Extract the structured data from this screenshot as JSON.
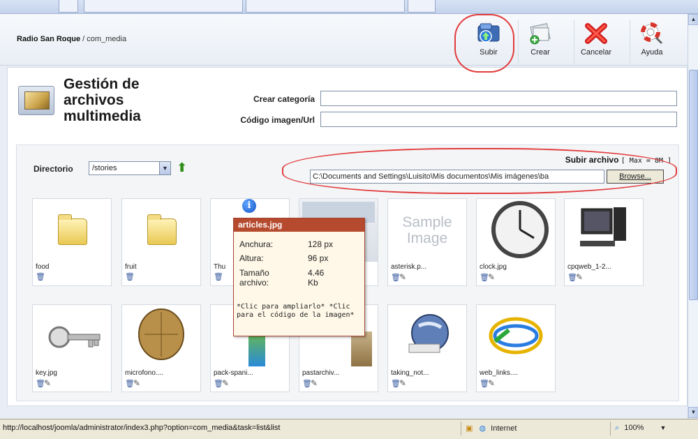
{
  "header": {
    "site_name": "Radio San Roque",
    "separator": " / ",
    "component": "com_media"
  },
  "toolbar": {
    "subir_label": "Subir",
    "crear_label": "Crear",
    "cancelar_label": "Cancelar",
    "ayuda_label": "Ayuda"
  },
  "page": {
    "title": "Gestión de archivos multimedia"
  },
  "form": {
    "crear_categoria_label": "Crear categoría",
    "crear_categoria_value": "",
    "codigo_label": "Código imagen/Url",
    "codigo_value": ""
  },
  "directory": {
    "label": "Directorio",
    "selected": "/stories"
  },
  "upload": {
    "label": "Subir archivo",
    "max": "[ Max = 8M ]",
    "file_value": "C:\\Documents and Settings\\Luisito\\Mis documentos\\Mis imágenes\\ba",
    "browse_label": "Browse..."
  },
  "items": [
    {
      "name": "food"
    },
    {
      "name": "fruit"
    },
    {
      "name": "Thu"
    },
    {
      "name": ""
    },
    {
      "name": "asterisk.p...",
      "placeholder": "Sample Image"
    },
    {
      "name": "clock.jpg"
    },
    {
      "name": "cpqweb_1-2..."
    },
    {
      "name": "key.jpg"
    },
    {
      "name": "microfono...."
    },
    {
      "name": "pack-spani..."
    },
    {
      "name": "pastarchiv..."
    },
    {
      "name": "taking_not..."
    },
    {
      "name": "web_links...."
    }
  ],
  "tooltip": {
    "info_glyph": "i",
    "title": "articles.jpg",
    "width_label": "Anchura:",
    "width_value": "128 px",
    "height_label": "Altura:",
    "height_value": "96 px",
    "size_label": "Tamaño archivo:",
    "size_value": "4.46 Kb",
    "hint": "*Clic para ampliarlo* *Clic para el código de la imagen*"
  },
  "statusbar": {
    "url": "http://localhost/joomla/administrator/index3.php?option=com_media&task=list&list",
    "zone": "Internet",
    "zoom": "100%"
  },
  "colors": {
    "tooltip_header": "#b64a2e",
    "annotation_red": "#e23b3b"
  }
}
